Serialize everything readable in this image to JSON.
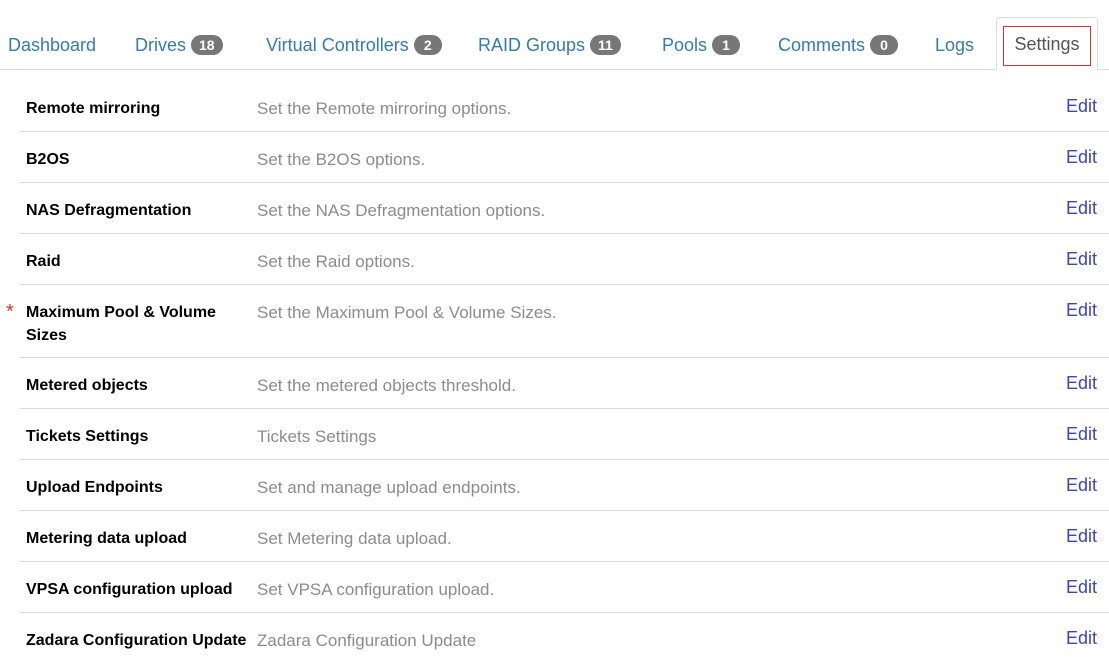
{
  "tabs": [
    {
      "label": "Dashboard",
      "badge": null
    },
    {
      "label": "Drives",
      "badge": "18"
    },
    {
      "label": "Virtual Controllers",
      "badge": "2"
    },
    {
      "label": "RAID Groups",
      "badge": "11"
    },
    {
      "label": "Pools",
      "badge": "1"
    },
    {
      "label": "Comments",
      "badge": "0"
    },
    {
      "label": "Logs",
      "badge": null
    },
    {
      "label": "Settings",
      "badge": null,
      "active": true
    }
  ],
  "settings": {
    "edit_label": "Edit",
    "rows": [
      {
        "name": "Remote mirroring",
        "description": "Set the Remote mirroring options."
      },
      {
        "name": "B2OS",
        "description": "Set the B2OS options."
      },
      {
        "name": "NAS Defragmentation",
        "description": "Set the NAS Defragmentation options."
      },
      {
        "name": "Raid",
        "description": "Set the Raid options."
      },
      {
        "name": "Maximum Pool & Volume Sizes",
        "description": "Set the Maximum Pool & Volume Sizes.",
        "required_marker": "*"
      },
      {
        "name": "Metered objects",
        "description": "Set the metered objects threshold."
      },
      {
        "name": "Tickets Settings",
        "description": "Tickets Settings"
      },
      {
        "name": "Upload Endpoints",
        "description": "Set and manage upload endpoints."
      },
      {
        "name": "Metering data upload",
        "description": "Set Metering data upload."
      },
      {
        "name": "VPSA configuration upload",
        "description": "Set VPSA configuration upload."
      },
      {
        "name": "Zadara Configuration Update",
        "description": "Zadara Configuration Update"
      }
    ]
  },
  "colors": {
    "link": "#337ab7",
    "edit_link": "#3b44c4",
    "badge_bg": "#777777",
    "required_marker": "#d9322b",
    "active_tab_outline": "#d9322b",
    "description_text": "#8c8c8c"
  }
}
